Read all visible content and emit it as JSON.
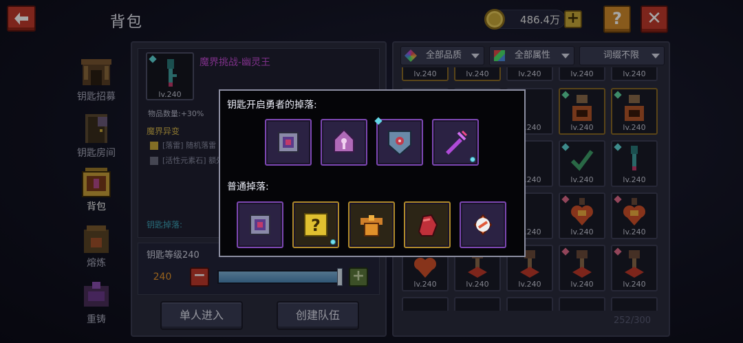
{
  "header": {
    "title": "背包",
    "coins": "486.4万",
    "coin_plus": "+",
    "help": "?",
    "close": "✕",
    "back": "🡐"
  },
  "sidebar": {
    "items": [
      {
        "label": "钥匙招募"
      },
      {
        "label": "钥匙房间"
      },
      {
        "label": "背包"
      },
      {
        "label": "熔炼"
      },
      {
        "label": "重铸"
      }
    ]
  },
  "detail": {
    "key_lv": "lv.240",
    "key_title": "魔界挑战-幽灵王",
    "stat": "物品数量:+30%",
    "variant_title": "魔界异变",
    "variant_1": "[落雷] 随机落雷",
    "variant_2": "[活性元素石] 额外增加伤...",
    "drops_label": "钥匙掉落:",
    "level_label": "钥匙等级240",
    "level_value": "240",
    "minus": "−",
    "plus": "+",
    "single_btn": "单人进入",
    "team_btn": "创建队伍"
  },
  "filters": {
    "quality": "全部品质",
    "attribute": "全部属性",
    "affix": "词缀不限"
  },
  "grid": {
    "cell_label": "lv.240",
    "count": "252/300"
  },
  "popup": {
    "hero_title": "钥匙开启勇者的掉落:",
    "normal_title": "普通掉落:"
  },
  "colors": {
    "accent_purple": "#7d47b3",
    "accent_gold": "#b08a2a",
    "title_pink": "#c24bd3",
    "back_red": "#c0392b"
  }
}
